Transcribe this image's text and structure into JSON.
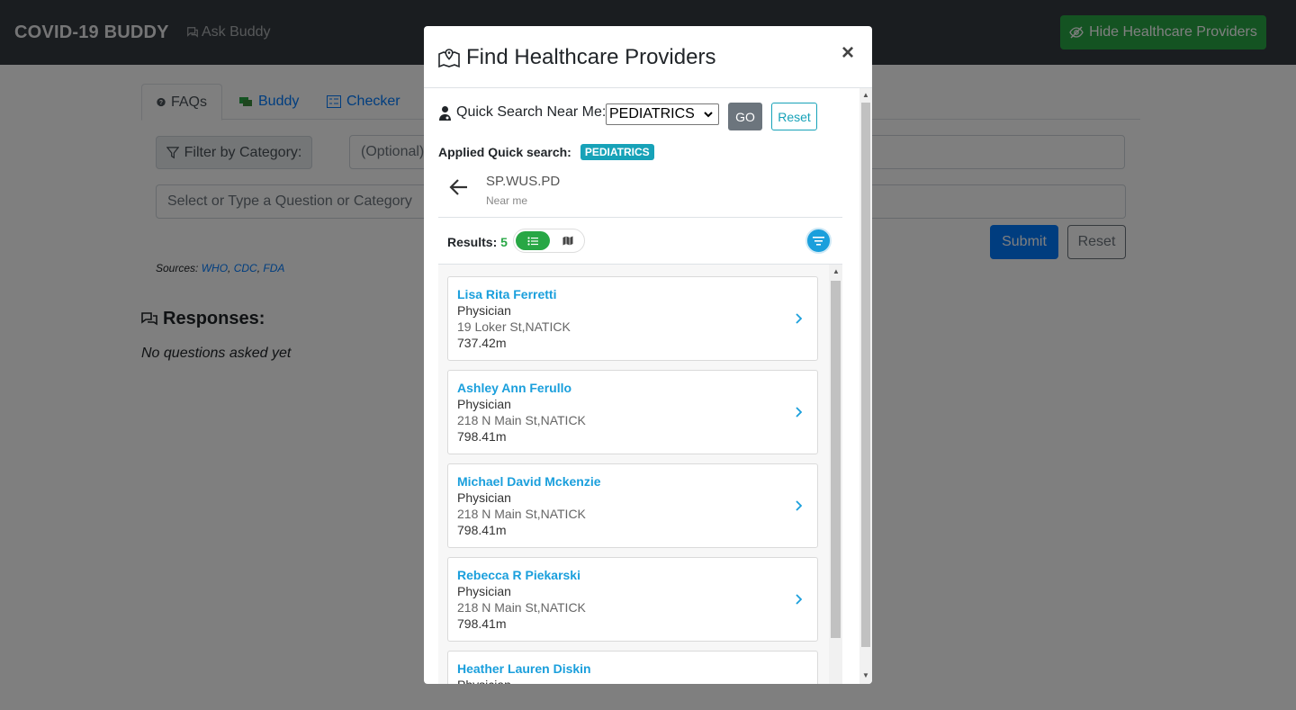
{
  "navbar": {
    "brand": "COVID-19 BUDDY",
    "ask_buddy": "Ask Buddy",
    "hide_providers": "Hide Healthcare Providers"
  },
  "tabs": [
    {
      "label": "FAQs",
      "icon": "question-circle-icon"
    },
    {
      "label": "Buddy",
      "icon": "chat-icon"
    },
    {
      "label": "Checker",
      "icon": "card-checklist-icon"
    }
  ],
  "filter": {
    "label": "Filter by Category:",
    "category_placeholder": "(Optional)",
    "question_placeholder": "Select or Type a Question or Category",
    "submit": "Submit",
    "reset": "Reset"
  },
  "sources": {
    "label": "Sources:",
    "links": [
      "WHO",
      "CDC",
      "FDA"
    ]
  },
  "responses": {
    "heading": "Responses:",
    "empty": "No questions asked yet"
  },
  "modal": {
    "title": "Find Healthcare Providers",
    "close": "×",
    "quick_search_label": "Quick Search Near Me:",
    "quick_search_value": "PEDIATRICS",
    "go": "GO",
    "reset": "Reset",
    "applied_label": "Applied Quick search:",
    "applied_badge": "PEDIATRICS",
    "location_title": "SP.WUS.PD",
    "location_sub": "Near me",
    "results_label": "Results:",
    "results_count": "5",
    "providers": [
      {
        "name": "Lisa Rita Ferretti",
        "role": "Physician",
        "address": "19 Loker St,NATICK",
        "distance": "737.42m"
      },
      {
        "name": "Ashley Ann Ferullo",
        "role": "Physician",
        "address": "218 N Main St,NATICK",
        "distance": "798.41m"
      },
      {
        "name": "Michael David Mckenzie",
        "role": "Physician",
        "address": "218 N Main St,NATICK",
        "distance": "798.41m"
      },
      {
        "name": "Rebecca R Piekarski",
        "role": "Physician",
        "address": "218 N Main St,NATICK",
        "distance": "798.41m"
      },
      {
        "name": "Heather Lauren Diskin",
        "role": "Physician",
        "address": "",
        "distance": ""
      }
    ]
  },
  "colors": {
    "navbar": "#343a40",
    "success": "#28a745",
    "primary": "#007bff",
    "info": "#17a2b8",
    "provider_name": "#1a9fdc"
  }
}
